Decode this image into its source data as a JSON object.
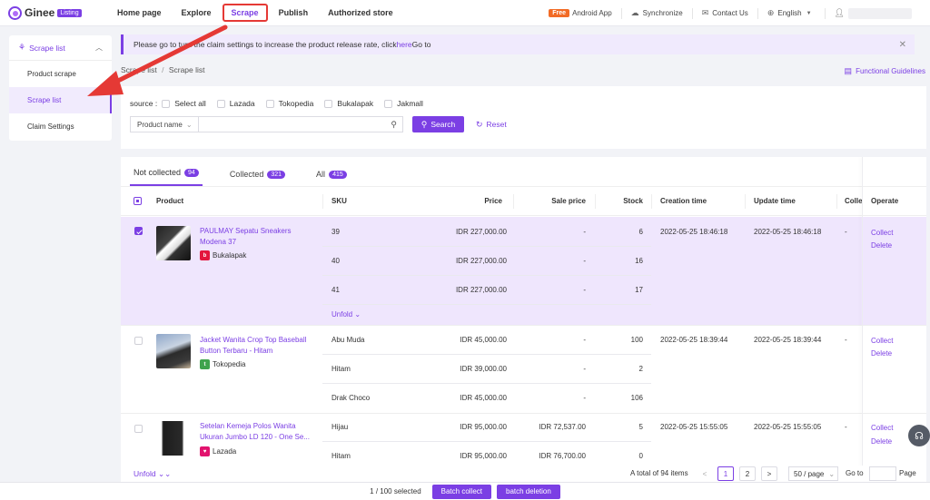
{
  "topnav": {
    "logo_text": "Ginee",
    "logo_badge": "Listing",
    "items": [
      "Home page",
      "Explore",
      "Scrape",
      "Publish",
      "Authorized store"
    ],
    "free_badge": "Free",
    "android_app": "Android App",
    "synchronize": "Synchronize",
    "contact_us": "Contact Us",
    "language": "English"
  },
  "sidebar": {
    "group_label": "Scrape list",
    "items": [
      "Product scrape",
      "Scrape list",
      "Claim Settings"
    ]
  },
  "notice": {
    "text_before": "Please go to turn the claim settings to increase the product release rate, click",
    "link": "here",
    "text_after": "Go to"
  },
  "breadcrumb": {
    "parent": "Scrape list",
    "separator": "/",
    "current": "Scrape list"
  },
  "functional_guidelines": "Functional Guidelines",
  "filter": {
    "source_label": "source :",
    "options": [
      "Select all",
      "Lazada",
      "Tokopedia",
      "Bukalapak",
      "Jakmall"
    ],
    "field_select": "Product name",
    "search_input": {
      "value": "",
      "placeholder": ""
    },
    "search_button": "Search",
    "reset_button": "Reset"
  },
  "tabs": [
    {
      "label": "Not collected",
      "count": "94"
    },
    {
      "label": "Collected",
      "count": "321"
    },
    {
      "label": "All",
      "count": "415"
    }
  ],
  "table": {
    "headers": [
      "Product",
      "SKU",
      "Price",
      "Sale price",
      "Stock",
      "Creation time",
      "Update time",
      "Colle",
      "Operate"
    ],
    "rows": [
      {
        "name_line1": "PAULMAY Sepatu Sneakers",
        "name_line2": "Modena 37",
        "platform": "Bukalapak",
        "selected": true,
        "skus": [
          {
            "sku": "39",
            "price": "IDR 227,000.00",
            "sale": "-",
            "stock": "6"
          },
          {
            "sku": "40",
            "price": "IDR 227,000.00",
            "sale": "-",
            "stock": "16"
          },
          {
            "sku": "41",
            "price": "IDR 227,000.00",
            "sale": "-",
            "stock": "17"
          }
        ],
        "unfold": "Unfold",
        "created": "2022-05-25 18:46:18",
        "updated": "2022-05-25 18:46:18",
        "colle": "-",
        "collect": "Collect",
        "delete": "Delete"
      },
      {
        "name_line1": "Jacket Wanita Crop Top Baseball",
        "name_line2": "Button Terbaru - Hitam",
        "platform": "Tokopedia",
        "selected": false,
        "skus": [
          {
            "sku": "Abu Muda",
            "price": "IDR 45,000.00",
            "sale": "-",
            "stock": "100"
          },
          {
            "sku": "Hitam",
            "price": "IDR 39,000.00",
            "sale": "-",
            "stock": "2"
          },
          {
            "sku": "Drak Choco",
            "price": "IDR 45,000.00",
            "sale": "-",
            "stock": "106"
          }
        ],
        "created": "2022-05-25 18:39:44",
        "updated": "2022-05-25 18:39:44",
        "colle": "-",
        "collect": "Collect",
        "delete": "Delete"
      },
      {
        "name_line1": "Setelan Kemeja Polos Wanita",
        "name_line2": "Ukuran Jumbo LD 120 - One Se...",
        "platform": "Lazada",
        "selected": false,
        "skus": [
          {
            "sku": "Hijau",
            "price": "IDR 95,000.00",
            "sale": "IDR 72,537.00",
            "stock": "5"
          },
          {
            "sku": "Hitam",
            "price": "IDR 95,000.00",
            "sale": "IDR 76,700.00",
            "stock": "0"
          }
        ],
        "created": "2022-05-25 15:55:05",
        "updated": "2022-05-25 15:55:05",
        "colle": "-",
        "collect": "Collect",
        "delete": "Delete"
      }
    ]
  },
  "pagination": {
    "unfold": "Unfold",
    "total_text": "A total of 94 items",
    "prev": "<",
    "pages": [
      "1",
      "2"
    ],
    "next": ">",
    "per_page": "50 / page",
    "goto": "Go to",
    "goto_value": "",
    "page_label": "Page"
  },
  "footer": {
    "selected_text": "1 / 100 selected",
    "batch_collect": "Batch collect",
    "batch_deletion": "batch deletion"
  },
  "colors": {
    "accent": "#7b3fe4",
    "selected_row": "#efe6fd",
    "annotation_red": "#e53935"
  }
}
